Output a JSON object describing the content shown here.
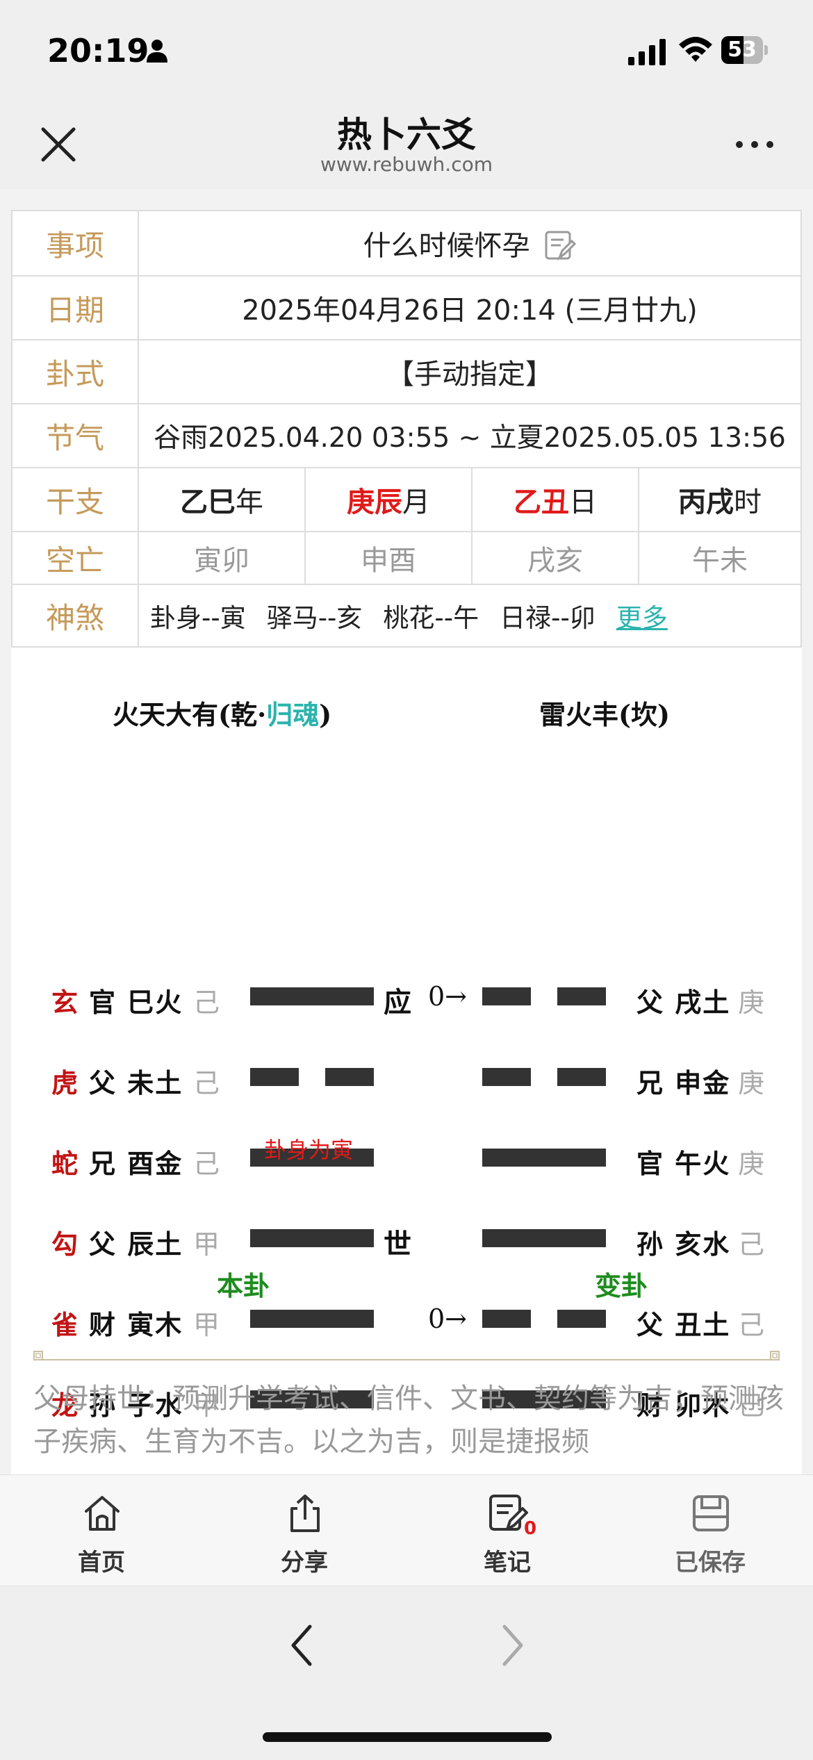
{
  "status_bar": {
    "time": "20:19",
    "battery": "53",
    "battery_level": 0.53
  },
  "nav": {
    "title": "热卜六爻",
    "subtitle": "www.rebuwh.com"
  },
  "info": {
    "item_label": "事项",
    "item_value": "什么时候怀孕",
    "date_label": "日期",
    "date_value": "2025年04月26日 20:14 (三月廿九)",
    "gua_label": "卦式",
    "gua_value": "【手动指定】",
    "jieqi_label": "节气",
    "jieqi_value": "谷雨2025.04.20 03:55 ~ 立夏2025.05.05 13:56",
    "ganzhi_label": "干支",
    "ganzhi": [
      {
        "gz": "乙巳",
        "unit": "年",
        "highlight": false
      },
      {
        "gz": "庚辰",
        "unit": "月",
        "highlight": true
      },
      {
        "gz": "乙丑",
        "unit": "日",
        "highlight": true
      },
      {
        "gz": "丙戌",
        "unit": "时",
        "highlight": false
      }
    ],
    "kongwang_label": "空亡",
    "kongwang": [
      "寅卯",
      "申酉",
      "戌亥",
      "午未"
    ],
    "shensha_label": "神煞",
    "shensha": [
      "卦身--寅",
      "驿马--亥",
      "桃花--午",
      "日禄--卯"
    ],
    "more": "更多"
  },
  "hexagram": {
    "left_name_a": "火天大有(乾·",
    "left_name_b": "归魂",
    "left_name_c": ")",
    "right_name": "雷火丰(坎)",
    "lines": [
      {
        "animal": "玄",
        "left": "官 巳火",
        "left_stem": "己",
        "left_type": "yang",
        "mark": "应",
        "moving": "0→",
        "right_type": "yin",
        "right": "父 戌土",
        "right_stem": "庚"
      },
      {
        "animal": "虎",
        "left": "父 未土",
        "left_stem": "己",
        "left_type": "yin",
        "mark": "",
        "moving": "",
        "right_type": "yin",
        "right": "兄 申金",
        "right_stem": "庚"
      },
      {
        "animal": "蛇",
        "left": "兄 酉金",
        "left_stem": "己",
        "left_type": "yang",
        "mark": "",
        "moving": "",
        "right_type": "yang",
        "right": "官 午火",
        "right_stem": "庚"
      },
      {
        "animal": "勾",
        "left": "父 辰土",
        "left_stem": "甲",
        "left_type": "yang",
        "mark": "世",
        "moving": "",
        "right_type": "yang",
        "right": "孙 亥水",
        "right_stem": "己"
      },
      {
        "animal": "雀",
        "left": "财 寅木",
        "left_stem": "甲",
        "left_type": "yang",
        "mark": "",
        "moving": "0→",
        "right_type": "yin",
        "right": "父 丑土",
        "right_stem": "己"
      },
      {
        "animal": "龙",
        "left": "孙 子水",
        "left_stem": "甲",
        "left_type": "yang",
        "mark": "",
        "moving": "",
        "right_type": "yang",
        "right": "财 卯木",
        "right_stem": "己"
      }
    ],
    "guashen_note": "卦身为寅",
    "ben_label": "本卦",
    "bian_label": "变卦"
  },
  "description": "父母持世：预测升学考试、信件、文书、契约等为吉；预测孩子疾病、生育为不吉。以之为吉，则是捷报频",
  "tabbar": {
    "home": "首页",
    "share": "分享",
    "notes": "笔记",
    "notes_badge": "0",
    "saved": "已保存"
  }
}
